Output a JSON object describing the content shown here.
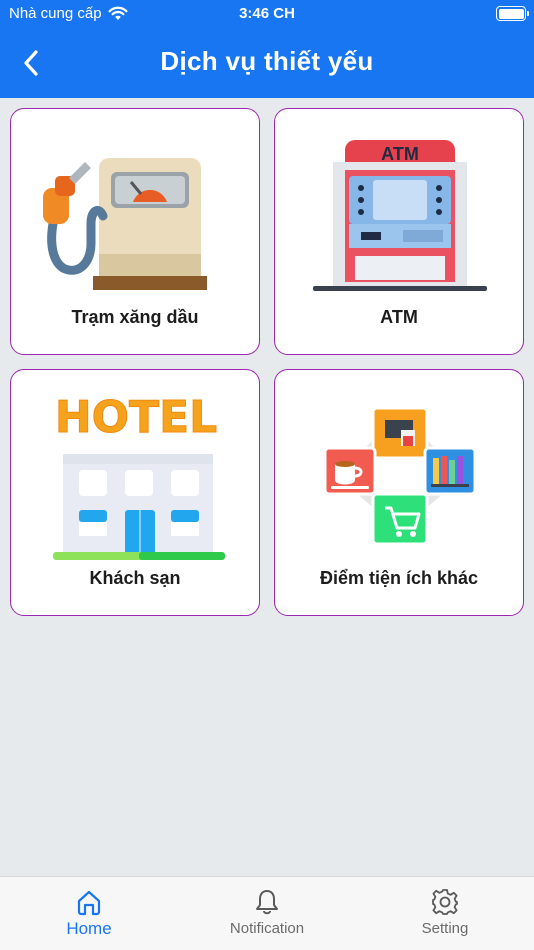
{
  "status_bar": {
    "carrier": "Nhà cung cấp",
    "time": "3:46 CH"
  },
  "header": {
    "title": "Dịch vụ thiết yếu"
  },
  "services": [
    {
      "label": "Trạm xăng dầu",
      "icon": "gas-station-icon"
    },
    {
      "label": "ATM",
      "icon": "atm-icon"
    },
    {
      "label": "Khách sạn",
      "icon": "hotel-icon"
    },
    {
      "label": "Điểm tiện ích khác",
      "icon": "other-amenities-icon"
    }
  ],
  "icon_texts": {
    "atm_sign": "ATM",
    "hotel_sign": "HOTEL"
  },
  "tabbar": {
    "tabs": [
      {
        "label": "Home",
        "icon": "home-icon",
        "active": true
      },
      {
        "label": "Notification",
        "icon": "bell-icon",
        "active": false
      },
      {
        "label": "Setting",
        "icon": "gear-icon",
        "active": false
      }
    ]
  },
  "colors": {
    "primary": "#1976f2",
    "card_border": "#9c27b0",
    "background": "#e7eaed"
  }
}
